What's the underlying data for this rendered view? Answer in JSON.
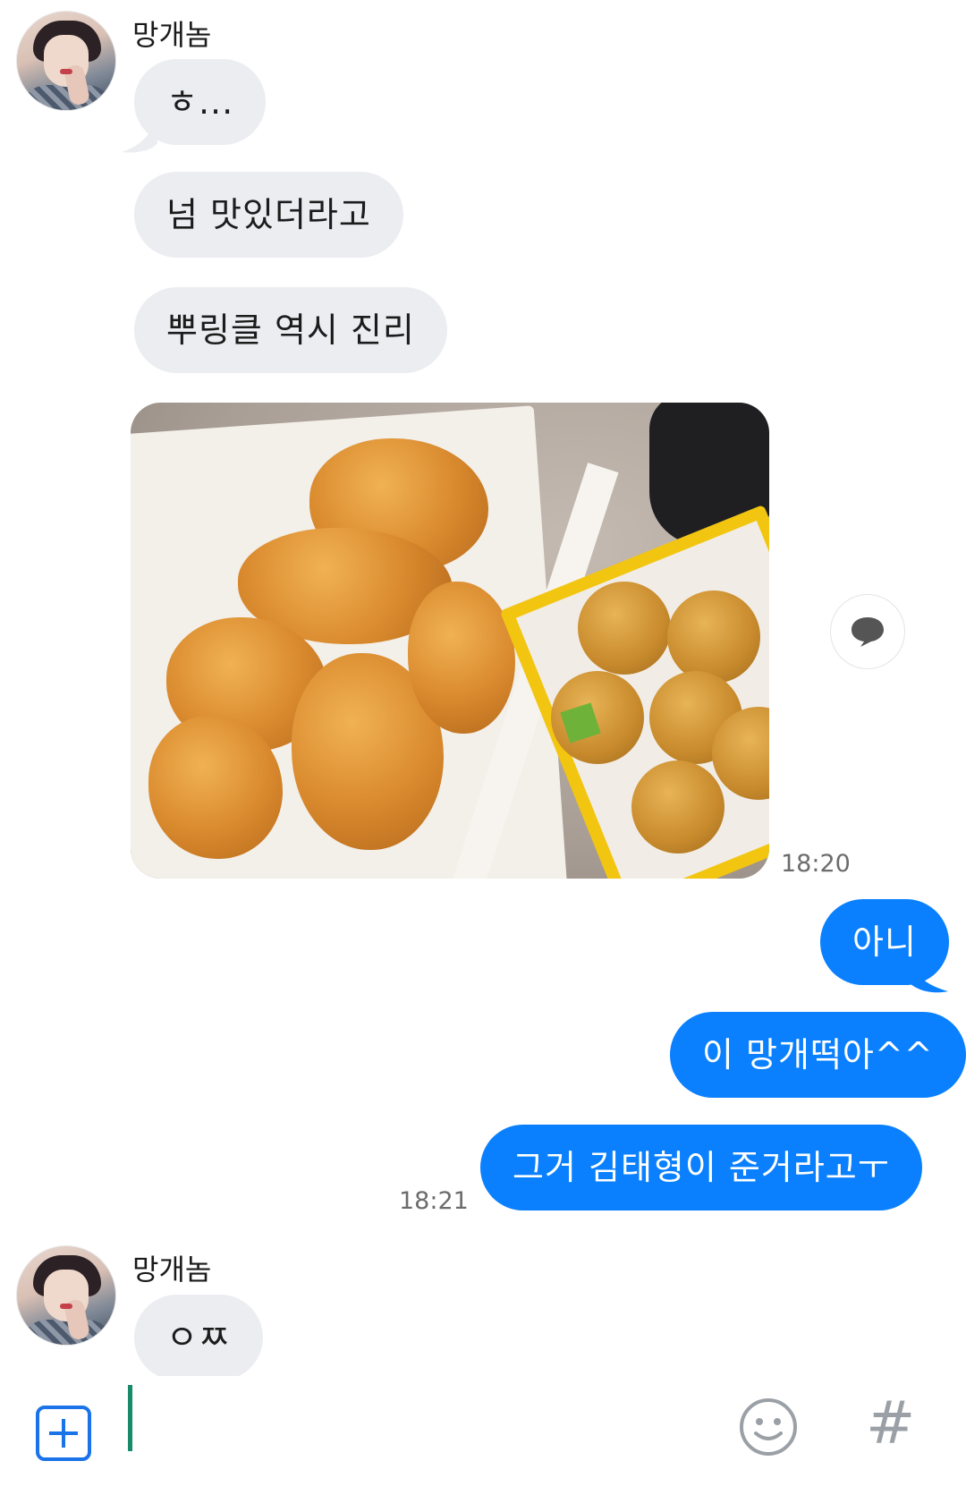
{
  "chat": {
    "first_group": {
      "sender": "망개놈",
      "messages": [
        "ㅎ...",
        "넘 맛있더라고",
        "뿌링클 역시 진리"
      ],
      "photo_time": "18:20"
    },
    "outgoing": {
      "messages": [
        "아니",
        "이 망개떡아^^",
        "그거 김태형이 준거라고ㅜ"
      ],
      "time": "18:21"
    },
    "second_group": {
      "sender": "망개놈",
      "messages": [
        "ㅇㅉ"
      ]
    }
  },
  "composer": {
    "plus_icon": "plus-icon",
    "emoji_icon": "emoji-icon",
    "hash_label": "#"
  },
  "colors": {
    "outgoing_bubble": "#0a80fe",
    "incoming_bubble": "#ecedf1",
    "accent": "#1a73e8"
  }
}
